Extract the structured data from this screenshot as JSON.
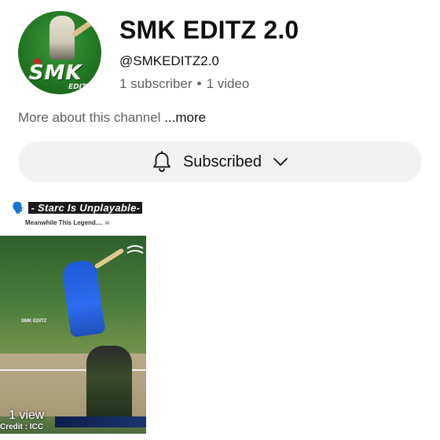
{
  "channel": {
    "name": "SMK EDITZ 2.0",
    "handle": "@SMKEDITZ2.0",
    "subscribers": "1 subscriber",
    "separator": "•",
    "videos": "1 video",
    "avatar_logo": "SMK",
    "avatar_logo_sub": "EDITZ"
  },
  "about": {
    "text": "More about this channel",
    "more_label": "...more"
  },
  "subscribe_button": {
    "label": "Subscribed",
    "icon": "bell-icon",
    "dropdown_icon": "chevron-down-icon",
    "background": "#f2f2f2"
  },
  "short": {
    "emoji": "🗣️",
    "title": "- Starc Is Unplayable-",
    "subtitle": "Meanwhile This Legend.... ☠",
    "views": "1 view",
    "credit": "Credit : ICC",
    "watermark": "SMK EDITZ"
  },
  "colors": {
    "text_primary": "#0f0f0f",
    "text_secondary": "#606060",
    "button_bg": "#f2f2f2"
  }
}
